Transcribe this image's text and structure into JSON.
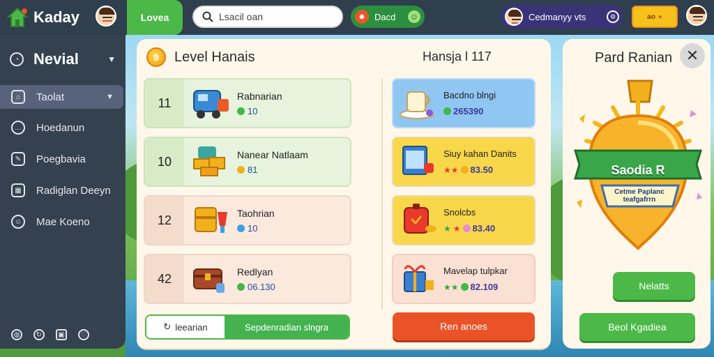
{
  "brand": {
    "name": "Kaday"
  },
  "header": {
    "green_tab": "Lovea",
    "search_placeholder": "Lsacil oan",
    "pill_label": "Dacd",
    "user_name": "Cedmanyy vts",
    "coins_label": "ao"
  },
  "sidebar": {
    "title": "Nevial",
    "items": [
      {
        "label": "Taolat",
        "icon": "home-icon"
      },
      {
        "label": "Hoedanun",
        "icon": "chat-icon"
      },
      {
        "label": "Poegbavia",
        "icon": "edit-icon"
      },
      {
        "label": "Radiglan Deeyn",
        "icon": "grid-icon"
      },
      {
        "label": "Mae Koeno",
        "icon": "people-icon"
      }
    ]
  },
  "main": {
    "title": "Level Hanais",
    "right_title": "Hansja l 117",
    "levels": [
      {
        "num": "11",
        "name": "Rabnarian",
        "price": "10",
        "gem": "green"
      },
      {
        "num": "10",
        "name": "Nanear Natlaam",
        "price": "81",
        "gem": "gold"
      },
      {
        "num": "12",
        "name": "Taohrian",
        "price": "10",
        "gem": "blue"
      },
      {
        "num": "42",
        "name": "Redlyan",
        "price": "06.130",
        "gem": "green"
      }
    ],
    "shop": [
      {
        "name": "Bacdno blngi",
        "price": "265390",
        "bg": "#8fc6f2"
      },
      {
        "name": "Siuy kahan Danits",
        "price": "83.50",
        "bg": "#f9d74a"
      },
      {
        "name": "Snolcbs",
        "price": "83.40",
        "bg": "#f9d74a"
      },
      {
        "name": "Mavelap tulpkar",
        "price": "82.109",
        "bg": "#fbe1d4"
      }
    ],
    "toggle_a": "leearian",
    "toggle_b": "Sepdenradian slngra",
    "orange_btn": "Ren anoes"
  },
  "reward": {
    "title": "Pard Ranian",
    "badge_title": "Saodia R",
    "badge_sub": "Cetme Paplanc teafgafrrn",
    "btn1": "Nelatts",
    "btn2": "Beol Kgadiea"
  },
  "colors": {
    "accent_green": "#4cb848",
    "accent_orange": "#ea5328",
    "sidebar": "#34414f"
  }
}
